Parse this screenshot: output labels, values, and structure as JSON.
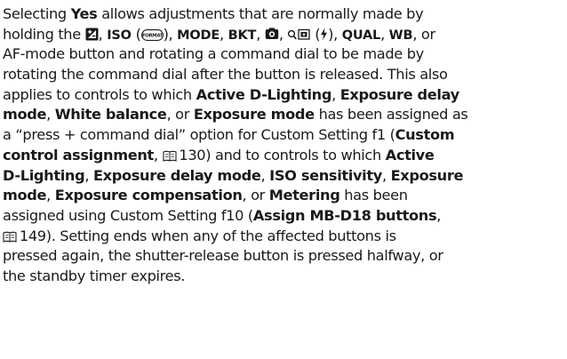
{
  "paragraph": {
    "l1": {
      "a": "Selecting ",
      "b1": "Yes",
      "c": " allows adjustments that are normally made by"
    },
    "l2": {
      "a": "holding the ",
      "b_iso": "ISO",
      "b_mode": "MODE",
      "b_bkt": "BKT",
      "b_qual": "QUAL",
      "b_wb": "WB",
      "sep1": ", ",
      "sep2": " (",
      "sep3": "), ",
      "sep4": ", ",
      "sep5": ", ",
      "sep6": ", ",
      "sep7": " (",
      "sep8": "), ",
      "sep9": ", ",
      "end": ", or"
    },
    "l3": {
      "a": "AF-mode button and rotating a command dial to be made by"
    },
    "l4": {
      "a": "rotating the command dial after the button is released. This also"
    },
    "l5": {
      "a": "applies to controls to which ",
      "b1": "Active D-Lighting",
      "c": ", ",
      "b2": "Exposure delay"
    },
    "l6": {
      "b1": "mode",
      "c": ", ",
      "b2": "White balance",
      "d": ", or ",
      "b3": "Exposure mode",
      "e": " has been assigned as"
    },
    "l7": {
      "a": "a “press + command dial” option for Custom Setting f1 (",
      "b1": "Custom"
    },
    "l8": {
      "b1": "control assignment",
      "c": ", ",
      "ref": " 130) and to controls to which ",
      "b2": "Active"
    },
    "l9": {
      "b1": "D-Lighting",
      "c": ", ",
      "b2": "Exposure delay mode",
      "d": ", ",
      "b3": "ISO sensitivity",
      "e": ", ",
      "b4": "Exposure"
    },
    "l10": {
      "b1": "mode",
      "c": ", ",
      "b2": "Exposure compensation",
      "d": ", or ",
      "b3": "Metering",
      "e": " has been"
    },
    "l11": {
      "a": "assigned using Custom Setting f10 (",
      "b1": "Assign MB-D18 buttons",
      "c": ","
    },
    "l12": {
      "ref": " 149). Setting ends when any of the affected buttons is"
    },
    "l13": {
      "a": "pressed again, the shutter-release button is pressed halfway, or"
    },
    "l14": {
      "a": "the standby timer expires."
    }
  },
  "icons": {
    "exposure_comp": "exposure-compensation-icon",
    "format": "format-button-icon",
    "flash_mode": "flash-mode-icon",
    "metering": "metering-icon",
    "flash_bolt": "flash-icon",
    "manual_ref": "book-reference-icon",
    "format_label": "FORMAT"
  }
}
